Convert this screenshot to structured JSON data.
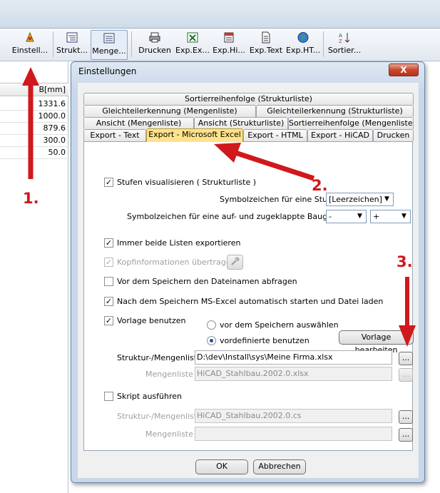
{
  "toolbar": {
    "buttons": [
      {
        "label": "Einstell...",
        "icon": "settings-icon"
      },
      {
        "label": "Strukt...",
        "icon": "structure-list-icon"
      },
      {
        "label": "Menge...",
        "icon": "quantity-list-icon"
      },
      {
        "label": "Drucken",
        "icon": "printer-icon"
      },
      {
        "label": "Exp.Ex...",
        "icon": "excel-icon"
      },
      {
        "label": "Exp.Hi...",
        "icon": "hicad-icon"
      },
      {
        "label": "Exp.Text",
        "icon": "text-file-icon"
      },
      {
        "label": "Exp.HT...",
        "icon": "globe-icon"
      },
      {
        "label": "Sortier...",
        "icon": "sort-icon"
      }
    ]
  },
  "grid": {
    "header": "B[mm]",
    "values": [
      "1331.6",
      "1000.0",
      "879.6",
      "300.0",
      "50.0"
    ]
  },
  "annotations": {
    "n1": "1.",
    "n2": "2.",
    "n3": "3.",
    "color": "#d0191c"
  },
  "dialog": {
    "title": "Einstellungen",
    "close": "X",
    "tabs": {
      "row1": [
        "Sortierreihenfolge (Strukturliste)"
      ],
      "row2": [
        "Gleichteilerkennung (Mengenliste)",
        "Gleichteilerkennung (Strukturliste)"
      ],
      "row3": [
        "Ansicht (Mengenliste)",
        "Ansicht (Strukturliste)",
        "Sortierreihenfolge (Mengenliste)"
      ],
      "row4": [
        "Export - Text",
        "Export - Microsoft Excel",
        "Export - HTML",
        "Export - HiCAD",
        "Drucken"
      ]
    },
    "active_tab": "Export - Microsoft Excel",
    "stufen": {
      "label": "Stufen visualisieren ( Strukturliste  )",
      "checked": true
    },
    "symbol_stufe": {
      "label": "Symbolzeichen für eine Stufe :",
      "value": "[Leerzeichen]"
    },
    "symbol_baugruppe": {
      "label": "Symbolzeichen für eine auf- und zugeklappte Baugruppe :",
      "value1": "-",
      "value2": "+"
    },
    "beide_listen": {
      "label": "Immer beide Listen exportieren",
      "checked": true
    },
    "kopfinfo": {
      "label": "Kopfinformationen übertragen",
      "checked": true
    },
    "dateinamen": {
      "label": "Vor dem Speichern den Dateinamen abfragen",
      "checked": false
    },
    "ms_excel": {
      "label": "Nach dem Speichern MS-Excel automatisch starten und Datei laden",
      "checked": true
    },
    "vorlage": {
      "label": "Vorlage benutzen",
      "checked": true
    },
    "radio_vor": "vor dem Speichern auswählen",
    "radio_vordef": "vordefinierte benutzen",
    "vorlage_btn": "Vorlage bearbeiten",
    "struktur_label": "Struktur-/Mengenliste",
    "struktur_value": "D:\\dev\\Install\\sys\\Meine Firma.xlsx",
    "mengen_label": "Mengenliste :",
    "mengen_value": "HiCAD_Stahlbau.2002.0.xlsx",
    "skript": {
      "label": "Skript ausführen",
      "checked": false
    },
    "skript_struktur_label": "Struktur-/Mengenliste",
    "skript_struktur_value": "HiCAD_Stahlbau.2002.0.cs",
    "skript_mengen_label": "Mengenliste :",
    "skript_mengen_value": "",
    "browse": "...",
    "ok": "OK",
    "cancel": "Abbrechen"
  }
}
